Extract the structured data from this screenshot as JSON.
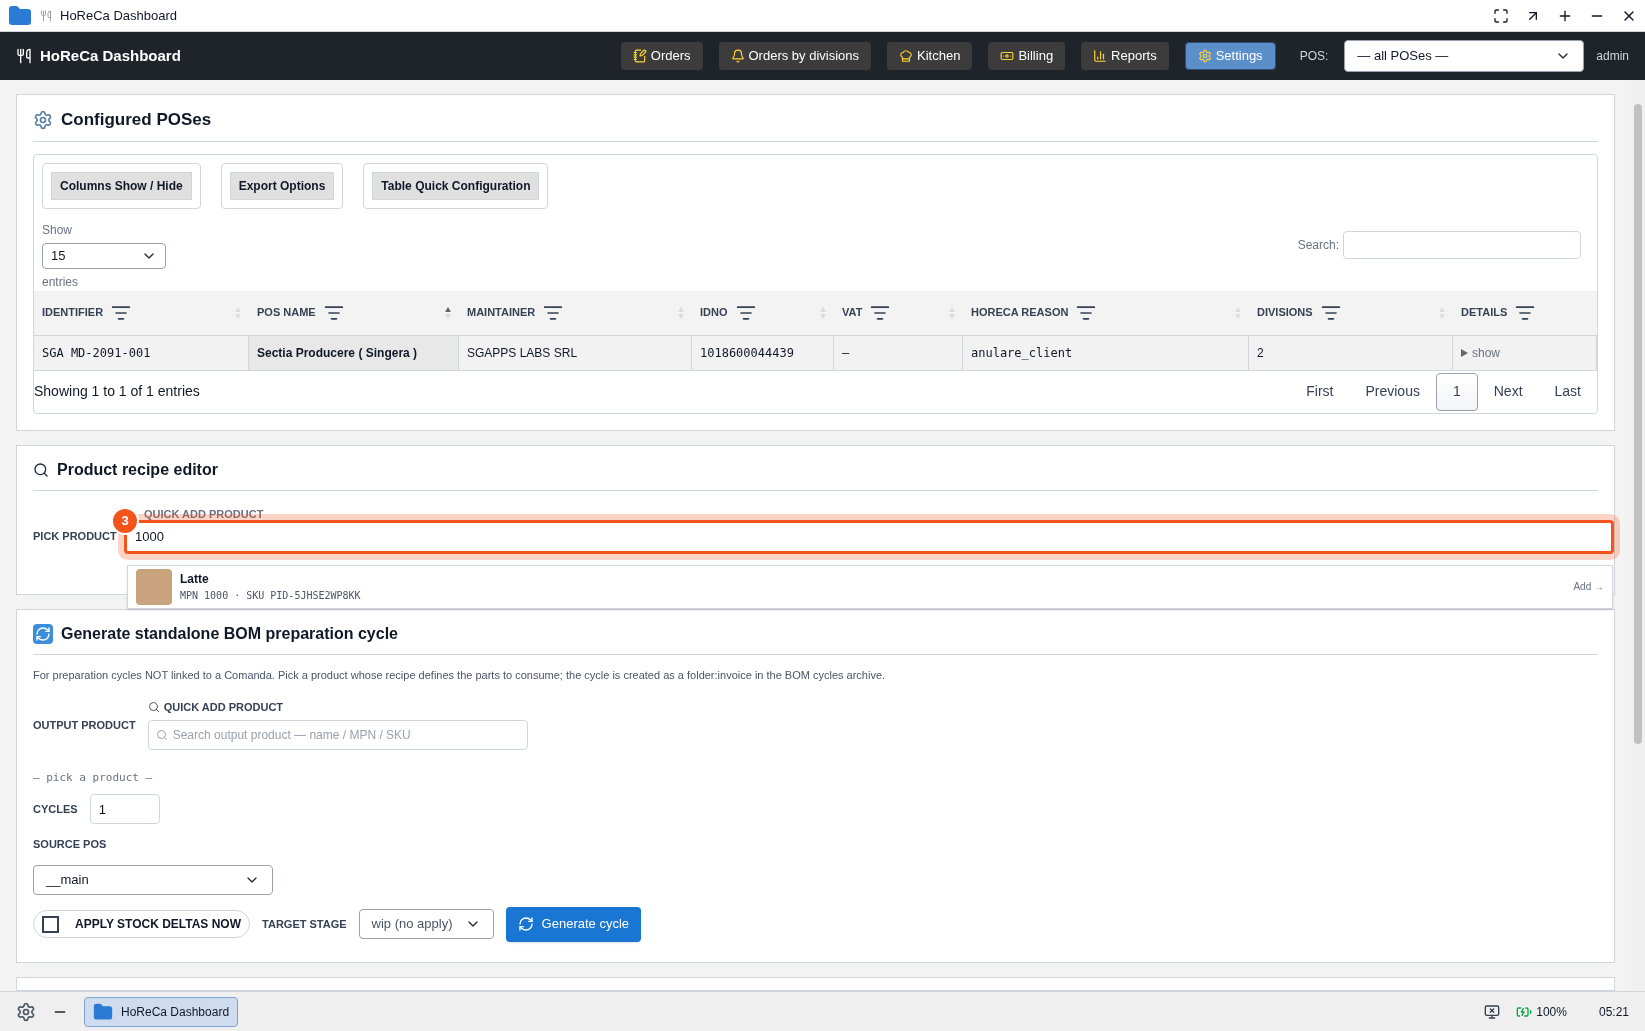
{
  "window": {
    "title": "HoReCa Dashboard"
  },
  "navbar": {
    "brand": "HoReCa Dashboard",
    "buttons": [
      {
        "label": "Orders",
        "selected": false
      },
      {
        "label": "Orders by divisions",
        "selected": false
      },
      {
        "label": "Kitchen",
        "selected": false
      },
      {
        "label": "Billing",
        "selected": false
      },
      {
        "label": "Reports",
        "selected": false
      },
      {
        "label": "Settings",
        "selected": true
      }
    ],
    "pos_label": "POS:",
    "pos_value": "— all POSes —",
    "user": "admin"
  },
  "configured_poses": {
    "title": "Configured POSes",
    "toolbar": [
      "Columns Show / Hide",
      "Export Options",
      "Table Quick Configuration"
    ],
    "show_label": "Show",
    "show_value": "15",
    "entries_label": "entries",
    "search_label": "Search:",
    "columns": [
      {
        "label": "IDENTIFIER",
        "sorted": false
      },
      {
        "label": "POS NAME",
        "sorted": true
      },
      {
        "label": "MAINTAINER",
        "sorted": false
      },
      {
        "label": "IDNO",
        "sorted": false
      },
      {
        "label": "VAT",
        "sorted": false
      },
      {
        "label": "HORECA REASON",
        "sorted": false
      },
      {
        "label": "DIVISIONS",
        "sorted": false
      },
      {
        "label": "DETAILS"
      }
    ],
    "rows": [
      {
        "identifier": "SGA MD-2091-001",
        "pos_name": "Sectia Producere ( Singera )",
        "maintainer": "SGAPPS LABS SRL",
        "idno": "1018600044439",
        "vat": "—",
        "horeca_reason": "anulare_client",
        "divisions": "2",
        "details": "show"
      }
    ],
    "info": "Showing 1 to 1 of 1 entries",
    "pagination": [
      {
        "label": "First",
        "selected": false
      },
      {
        "label": "Previous",
        "selected": false
      },
      {
        "label": "1",
        "selected": true
      },
      {
        "label": "Next",
        "selected": false
      },
      {
        "label": "Last",
        "selected": false
      }
    ]
  },
  "recipe_editor": {
    "title": "Product recipe editor",
    "pick_label": "PICK PRODUCT",
    "quick_add_label": "QUICK ADD PRODUCT",
    "value": "1000",
    "badge": "3",
    "suggestions": [
      {
        "name": "Latte",
        "meta": "MPN 1000 · SKU PID-5JHSE2WP8KK",
        "action": "Add →"
      }
    ]
  },
  "bom_cycle": {
    "title": "Generate standalone BOM preparation cycle",
    "description": "For preparation cycles NOT linked to a Comanda. Pick a product whose recipe defines the parts to consume; the cycle is created as a folder:invoice in the BOM cycles archive.",
    "quick_add_label": "QUICK ADD PRODUCT",
    "output_label": "OUTPUT PRODUCT",
    "output_placeholder": "Search output product — name / MPN / SKU",
    "picked": "— pick a product —",
    "cycles_label": "CYCLES",
    "cycles_value": "1",
    "source_label": "SOURCE POS",
    "source_value": "__main",
    "apply_label": "APPLY STOCK DELTAS NOW",
    "apply_checked": false,
    "stage_label": "TARGET STAGE",
    "stage_value": "wip (no apply)",
    "generate": "Generate cycle"
  },
  "taskbar": {
    "app": "HoReCa Dashboard",
    "battery": "100%",
    "time": "05:21"
  }
}
